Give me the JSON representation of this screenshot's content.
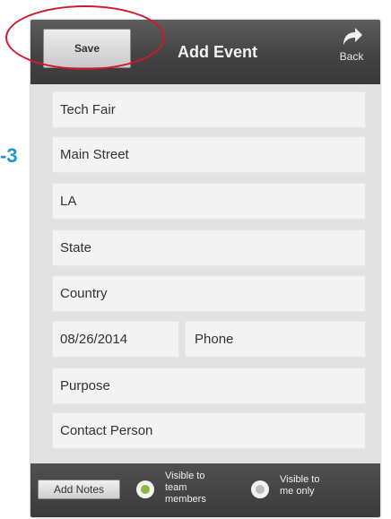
{
  "step_marker": "-3",
  "topbar": {
    "save_label": "Save",
    "title": "Add Event",
    "back_label": "Back"
  },
  "form": {
    "event_name": "Tech Fair",
    "street": "Main Street",
    "city": "LA",
    "state_placeholder": "State",
    "country_placeholder": "Country",
    "date": "08/26/2014",
    "phone_placeholder": "Phone",
    "purpose_placeholder": "Purpose",
    "contact_placeholder": "Contact Person"
  },
  "bottombar": {
    "add_notes_label": "Add Notes",
    "visibility_team_line1": "Visible to",
    "visibility_team_line2": "team",
    "visibility_team_line3": "members",
    "visibility_me_line1": "Visible to",
    "visibility_me_line2": "me only",
    "selected_visibility": "team"
  },
  "colors": {
    "accent_green": "#8ab83c",
    "highlight_red": "#d0182a",
    "marker_blue": "#1e96d2"
  }
}
